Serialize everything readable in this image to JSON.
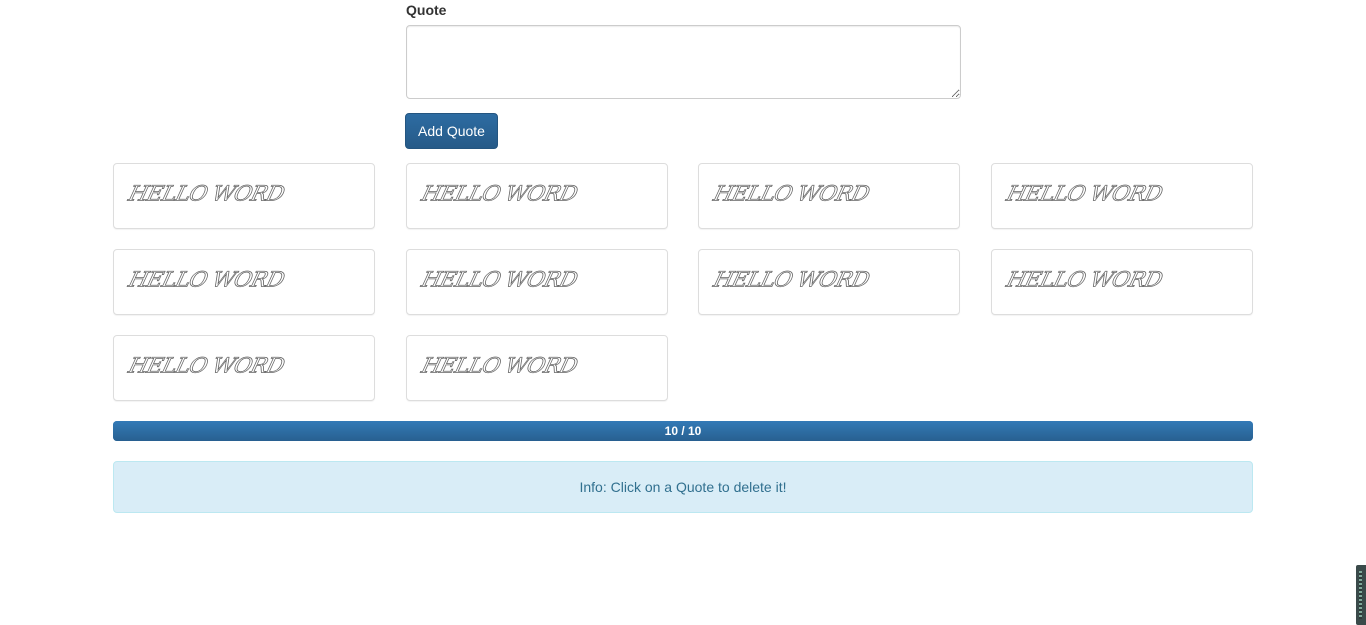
{
  "form": {
    "label": "Quote",
    "textarea_value": "",
    "button_label": "Add Quote"
  },
  "quotes": [
    "HELLO WORD",
    "HELLO WORD",
    "HELLO WORD",
    "HELLO WORD",
    "HELLO WORD",
    "HELLO WORD",
    "HELLO WORD",
    "HELLO WORD",
    "HELLO WORD",
    "HELLO WORD"
  ],
  "progress": {
    "label": "10 / 10",
    "value": 10,
    "max": 10
  },
  "info": {
    "text": "Info: Click on a Quote to delete it!"
  },
  "colors": {
    "primary": "#265a88",
    "progress": "#337ab7",
    "info_bg": "#d9edf7",
    "info_text": "#31708f"
  }
}
